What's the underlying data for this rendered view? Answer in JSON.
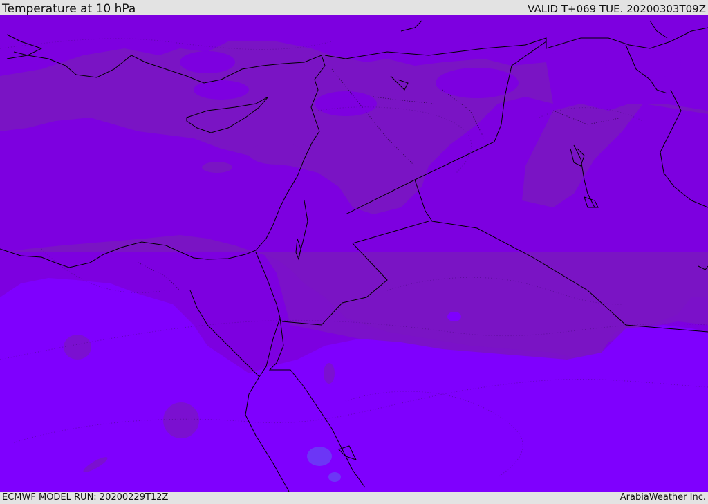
{
  "header": {
    "title": "Temperature at 10 hPa",
    "valid": "VALID T+069 TUE. 20200303T09Z"
  },
  "footer": {
    "model_run": "ECMWF MODEL RUN: 20200229T12Z",
    "credit": "ArabiaWeather Inc."
  },
  "colors": {
    "shade_dark": "#7a14c4",
    "shade_mid": "#7d00e0",
    "shade_light": "#7f00fe",
    "shade_blue": "#6a3cf5",
    "coastline": "#000000",
    "bar_background": "#e3e3e3"
  }
}
